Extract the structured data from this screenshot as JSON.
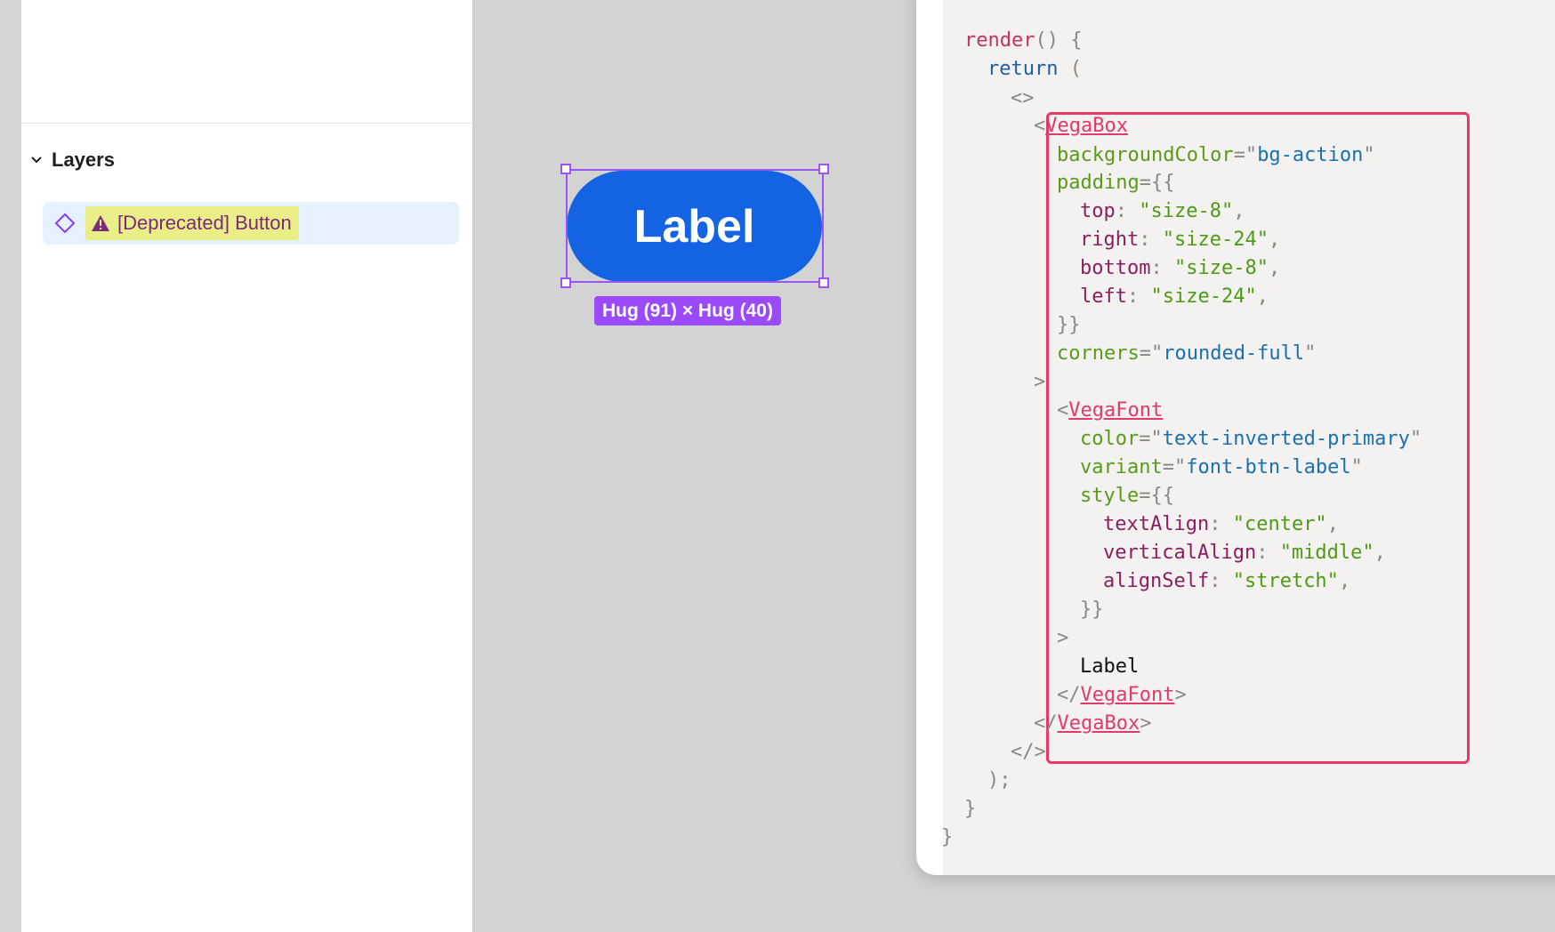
{
  "layers_panel": {
    "title": "Layers",
    "layer": {
      "name": "[Deprecated] Button",
      "component_icon": "component-diamond-icon",
      "warning_icon": "warning-triangle-icon"
    }
  },
  "canvas": {
    "button_label": "Label",
    "size_tag": "Hug (91) × Hug (40)",
    "colors": {
      "button": "#1363e3",
      "selection": "#9a55f3",
      "tag": "#9a49fb"
    }
  },
  "code": {
    "lines": [
      {
        "parts": [
          [
            "k-func",
            "render"
          ],
          [
            "k-punc",
            "() {"
          ]
        ]
      },
      {
        "parts": [
          [
            "k-kw",
            "return"
          ],
          [
            "k-punc",
            " ("
          ]
        ]
      },
      {
        "parts": [
          [
            "k-punc",
            "<>"
          ]
        ]
      },
      {
        "parts": [
          [
            "k-punc",
            "<"
          ],
          [
            "k-tag",
            "VegaBox"
          ]
        ]
      },
      {
        "parts": [
          [
            "k-attr",
            "backgroundColor"
          ],
          [
            "k-punc",
            "=\""
          ],
          [
            "k-str",
            "bg-action"
          ],
          [
            "k-punc",
            "\""
          ]
        ]
      },
      {
        "parts": [
          [
            "k-attr",
            "padding"
          ],
          [
            "k-punc",
            "={{"
          ]
        ]
      },
      {
        "parts": [
          [
            "k-prop",
            "top"
          ],
          [
            "k-punc",
            ": "
          ],
          [
            "k-strg",
            "\"size-8\""
          ],
          [
            "k-punc",
            ","
          ]
        ]
      },
      {
        "parts": [
          [
            "k-prop",
            "right"
          ],
          [
            "k-punc",
            ": "
          ],
          [
            "k-strg",
            "\"size-24\""
          ],
          [
            "k-punc",
            ","
          ]
        ]
      },
      {
        "parts": [
          [
            "k-prop",
            "bottom"
          ],
          [
            "k-punc",
            ": "
          ],
          [
            "k-strg",
            "\"size-8\""
          ],
          [
            "k-punc",
            ","
          ]
        ]
      },
      {
        "parts": [
          [
            "k-prop",
            "left"
          ],
          [
            "k-punc",
            ": "
          ],
          [
            "k-strg",
            "\"size-24\""
          ],
          [
            "k-punc",
            ","
          ]
        ]
      },
      {
        "parts": [
          [
            "k-punc",
            "}}"
          ]
        ]
      },
      {
        "parts": [
          [
            "k-attr",
            "corners"
          ],
          [
            "k-punc",
            "=\""
          ],
          [
            "k-str",
            "rounded-full"
          ],
          [
            "k-punc",
            "\""
          ]
        ]
      },
      {
        "parts": [
          [
            "k-punc",
            ">"
          ]
        ]
      },
      {
        "parts": [
          [
            "k-punc",
            "<"
          ],
          [
            "k-tag",
            "VegaFont"
          ]
        ]
      },
      {
        "parts": [
          [
            "k-attr",
            "color"
          ],
          [
            "k-punc",
            "=\""
          ],
          [
            "k-str",
            "text-inverted-primary"
          ],
          [
            "k-punc",
            "\""
          ]
        ]
      },
      {
        "parts": [
          [
            "k-attr",
            "variant"
          ],
          [
            "k-punc",
            "=\""
          ],
          [
            "k-str",
            "font-btn-label"
          ],
          [
            "k-punc",
            "\""
          ]
        ]
      },
      {
        "parts": [
          [
            "k-attr",
            "style"
          ],
          [
            "k-punc",
            "={{"
          ]
        ]
      },
      {
        "parts": [
          [
            "k-prop",
            "textAlign"
          ],
          [
            "k-punc",
            ": "
          ],
          [
            "k-strg",
            "\"center\""
          ],
          [
            "k-punc",
            ","
          ]
        ]
      },
      {
        "parts": [
          [
            "k-prop",
            "verticalAlign"
          ],
          [
            "k-punc",
            ": "
          ],
          [
            "k-strg",
            "\"middle\""
          ],
          [
            "k-punc",
            ","
          ]
        ]
      },
      {
        "parts": [
          [
            "k-prop",
            "alignSelf"
          ],
          [
            "k-punc",
            ": "
          ],
          [
            "k-strg",
            "\"stretch\""
          ],
          [
            "k-punc",
            ","
          ]
        ]
      },
      {
        "parts": [
          [
            "k-punc",
            "}}"
          ]
        ]
      },
      {
        "parts": [
          [
            "k-punc",
            ">"
          ]
        ]
      },
      {
        "parts": [
          [
            "k-text",
            "Label"
          ]
        ]
      },
      {
        "parts": [
          [
            "k-punc",
            "</"
          ],
          [
            "k-tag",
            "VegaFont"
          ],
          [
            "k-punc",
            ">"
          ]
        ]
      },
      {
        "parts": [
          [
            "k-punc",
            "</"
          ],
          [
            "k-tag",
            "VegaBox"
          ],
          [
            "k-punc",
            ">"
          ]
        ]
      },
      {
        "parts": [
          [
            "k-punc",
            "</>"
          ]
        ]
      },
      {
        "parts": [
          [
            "k-punc",
            ");"
          ]
        ]
      },
      {
        "parts": [
          [
            "k-punc",
            "}"
          ]
        ]
      },
      {
        "parts": [
          [
            "k-punc",
            "}"
          ]
        ]
      }
    ]
  }
}
